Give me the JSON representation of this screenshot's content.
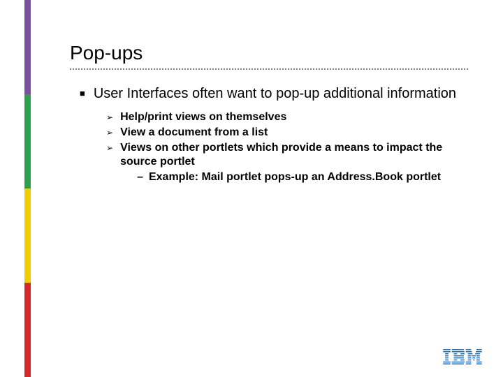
{
  "title": "Pop-ups",
  "main_bullet": "User Interfaces often want to pop-up additional information",
  "sub_bullets": [
    "Help/print views on themselves",
    "View a document from a list",
    "Views on other portlets which provide a means to impact the source portlet"
  ],
  "example_dash": "Example: Mail portlet pops-up an Address.Book portlet",
  "logo_label": "IBM"
}
